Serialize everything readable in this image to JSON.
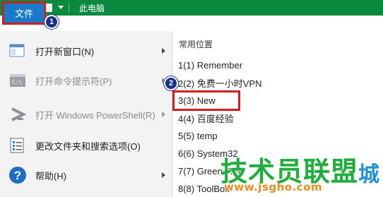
{
  "titlebar": {
    "title": "此电脑",
    "quick_access": [
      "computer-icon",
      "properties-check-icon",
      "new-folder-icon",
      "customize-dropdown-icon"
    ],
    "color": "#0a8a3e"
  },
  "file_tab": {
    "label": "文件",
    "color": "#1979ca"
  },
  "badges": {
    "one": "1",
    "two": "2"
  },
  "menu": {
    "items": [
      {
        "label": "打开新窗口(N)",
        "icon": "new-window-icon",
        "enabled": true,
        "has_submenu": true
      },
      {
        "label": "打开命令提示符(P)",
        "icon": "command-prompt-icon",
        "enabled": false,
        "has_submenu": true
      },
      {
        "label": "打开 Windows PowerShell(R)",
        "icon": "powershell-icon",
        "enabled": false,
        "has_submenu": true
      },
      {
        "label": "更改文件夹和搜索选项(O)",
        "icon": "folder-options-icon",
        "enabled": true,
        "has_submenu": false
      },
      {
        "label": "帮助(H)",
        "icon": "help-icon",
        "enabled": true,
        "has_submenu": true
      }
    ]
  },
  "recent": {
    "heading": "常用位置",
    "items": [
      {
        "label": "1(1)  Remember"
      },
      {
        "label": "2(2)  免费一小时VPN"
      },
      {
        "label": "3(3)  New"
      },
      {
        "label": "4(4)  百度经验"
      },
      {
        "label": "5(5)  temp"
      },
      {
        "label": "6(6)  System32"
      },
      {
        "label": "7(7)  Green Tree"
      },
      {
        "label": "8(8)  ToolBox"
      }
    ]
  },
  "watermark": {
    "big": "技术员联盟",
    "extra": "城",
    "small": "www.jsgho.com",
    "colors": {
      "big": "#1fae3c",
      "small": "#f08a1c"
    }
  },
  "highlight_color": "#d11f1f"
}
